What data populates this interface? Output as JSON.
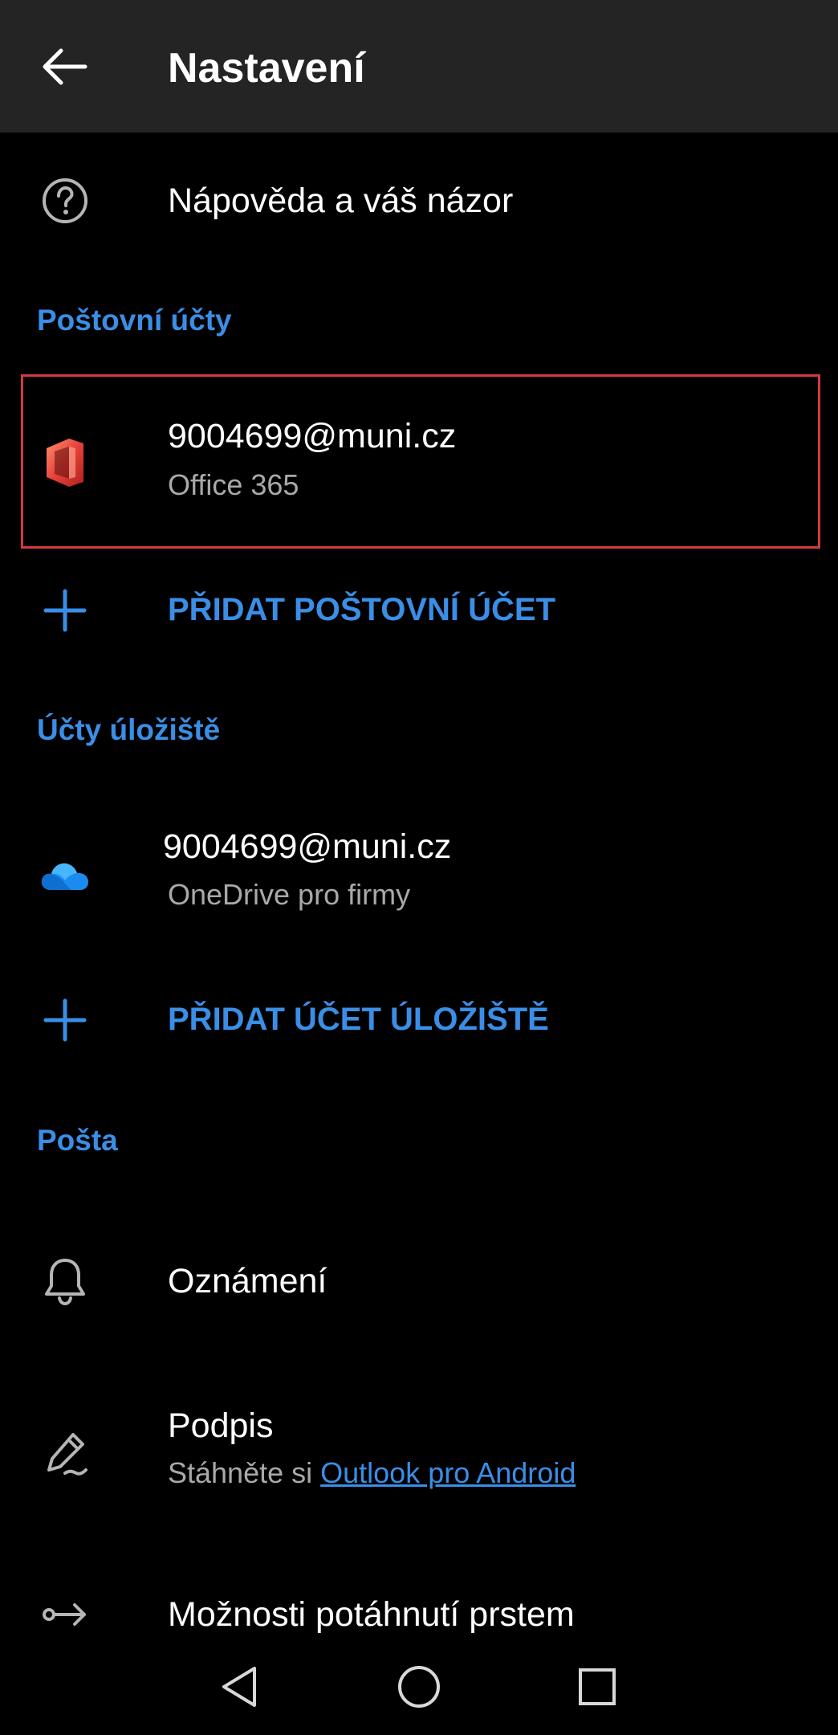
{
  "header": {
    "title": "Nastavení",
    "back_icon": "arrow-left-icon"
  },
  "help": {
    "label": "Nápověda a váš názor",
    "icon": "help-circle-icon"
  },
  "mail_accounts": {
    "section_title": "Poštovní účty",
    "account": {
      "email": "9004699@muni.cz",
      "type": "Office 365",
      "icon": "office-logo-icon"
    },
    "add_label": "PŘIDAT POŠTOVNÍ ÚČET",
    "add_icon": "plus-icon"
  },
  "storage_accounts": {
    "section_title": "Účty úložiště",
    "account": {
      "email": "9004699@muni.cz",
      "type": "OneDrive pro firmy",
      "icon": "onedrive-cloud-icon"
    },
    "add_label": "PŘIDAT ÚČET ÚLOŽIŠTĚ",
    "add_icon": "plus-icon"
  },
  "mail": {
    "section_title": "Pošta",
    "notifications": {
      "label": "Oznámení",
      "icon": "bell-icon"
    },
    "signature": {
      "label": "Podpis",
      "sub_prefix": "Stáhněte si",
      "sub_link": "Outlook pro Android",
      "icon": "signature-pen-icon"
    },
    "swipe": {
      "label": "Možnosti potáhnutí prstem",
      "icon": "swipe-arrow-icon"
    }
  },
  "nav_bar": {
    "back_icon": "nav-back-triangle-icon",
    "home_icon": "nav-home-circle-icon",
    "recents_icon": "nav-recents-square-icon"
  },
  "colors": {
    "background": "#000000",
    "app_bar": "#242424",
    "accent": "#3a8ee6",
    "highlight": "#d23a40",
    "secondary_text": "#a9a9a9"
  }
}
